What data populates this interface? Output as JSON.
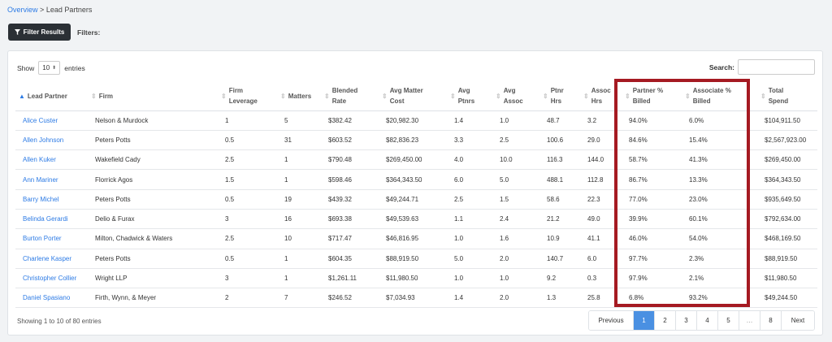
{
  "breadcrumb": {
    "link": "Overview",
    "sep": ">",
    "current": "Lead Partners"
  },
  "filter_button": {
    "label": "Filter Results",
    "icon": "filter-icon"
  },
  "filters_label": "Filters:",
  "show": {
    "prefix": "Show",
    "value": "10",
    "suffix": "entries"
  },
  "search": {
    "label": "Search:",
    "value": ""
  },
  "columns": [
    {
      "l1": "Lead Partner",
      "l2": ""
    },
    {
      "l1": "Firm",
      "l2": ""
    },
    {
      "l1": "Firm",
      "l2": "Leverage"
    },
    {
      "l1": "Matters",
      "l2": ""
    },
    {
      "l1": "Blended",
      "l2": "Rate"
    },
    {
      "l1": "Avg Matter",
      "l2": "Cost"
    },
    {
      "l1": "Avg",
      "l2": "Ptnrs"
    },
    {
      "l1": "Avg",
      "l2": "Assoc"
    },
    {
      "l1": "Ptnr",
      "l2": "Hrs"
    },
    {
      "l1": "Assoc",
      "l2": "Hrs"
    },
    {
      "l1": "Partner %",
      "l2": "Billed"
    },
    {
      "l1": "Associate %",
      "l2": "Billed"
    },
    {
      "l1": "Total",
      "l2": "Spend"
    }
  ],
  "rows": [
    [
      "Alice Custer",
      "Nelson & Murdock",
      "1",
      "5",
      "$382.42",
      "$20,982.30",
      "1.4",
      "1.0",
      "48.7",
      "3.2",
      "94.0%",
      "6.0%",
      "$104,911.50"
    ],
    [
      "Allen Johnson",
      "Peters Potts",
      "0.5",
      "31",
      "$603.52",
      "$82,836.23",
      "3.3",
      "2.5",
      "100.6",
      "29.0",
      "84.6%",
      "15.4%",
      "$2,567,923.00"
    ],
    [
      "Allen Kuker",
      "Wakefield Cady",
      "2.5",
      "1",
      "$790.48",
      "$269,450.00",
      "4.0",
      "10.0",
      "116.3",
      "144.0",
      "58.7%",
      "41.3%",
      "$269,450.00"
    ],
    [
      "Ann Mariner",
      "Florrick Agos",
      "1.5",
      "1",
      "$598.46",
      "$364,343.50",
      "6.0",
      "5.0",
      "488.1",
      "112.8",
      "86.7%",
      "13.3%",
      "$364,343.50"
    ],
    [
      "Barry Michel",
      "Peters Potts",
      "0.5",
      "19",
      "$439.32",
      "$49,244.71",
      "2.5",
      "1.5",
      "58.6",
      "22.3",
      "77.0%",
      "23.0%",
      "$935,649.50"
    ],
    [
      "Belinda Gerardi",
      "Delio & Furax",
      "3",
      "16",
      "$693.38",
      "$49,539.63",
      "1.1",
      "2.4",
      "21.2",
      "49.0",
      "39.9%",
      "60.1%",
      "$792,634.00"
    ],
    [
      "Burton Porter",
      "Milton, Chadwick & Waters",
      "2.5",
      "10",
      "$717.47",
      "$46,816.95",
      "1.0",
      "1.6",
      "10.9",
      "41.1",
      "46.0%",
      "54.0%",
      "$468,169.50"
    ],
    [
      "Charlene Kasper",
      "Peters Potts",
      "0.5",
      "1",
      "$604.35",
      "$88,919.50",
      "5.0",
      "2.0",
      "140.7",
      "6.0",
      "97.7%",
      "2.3%",
      "$88,919.50"
    ],
    [
      "Christopher Collier",
      "Wright LLP",
      "3",
      "1",
      "$1,261.11",
      "$11,980.50",
      "1.0",
      "1.0",
      "9.2",
      "0.3",
      "97.9%",
      "2.1%",
      "$11,980.50"
    ],
    [
      "Daniel Spasiano",
      "Firth, Wynn, & Meyer",
      "2",
      "7",
      "$246.52",
      "$7,034.93",
      "1.4",
      "2.0",
      "1.3",
      "25.8",
      "6.8%",
      "93.2%",
      "$49,244.50"
    ]
  ],
  "info": "Showing 1 to 10 of 80 entries",
  "pager": {
    "prev": "Previous",
    "pages": [
      "1",
      "2",
      "3",
      "4",
      "5"
    ],
    "ellipsis": "…",
    "last": "8",
    "next": "Next",
    "active": "1"
  },
  "colors": {
    "accent": "#2d7be5",
    "highlight": "#a51a22",
    "button_dark": "#2b3035",
    "active_page": "#4a90e2"
  }
}
